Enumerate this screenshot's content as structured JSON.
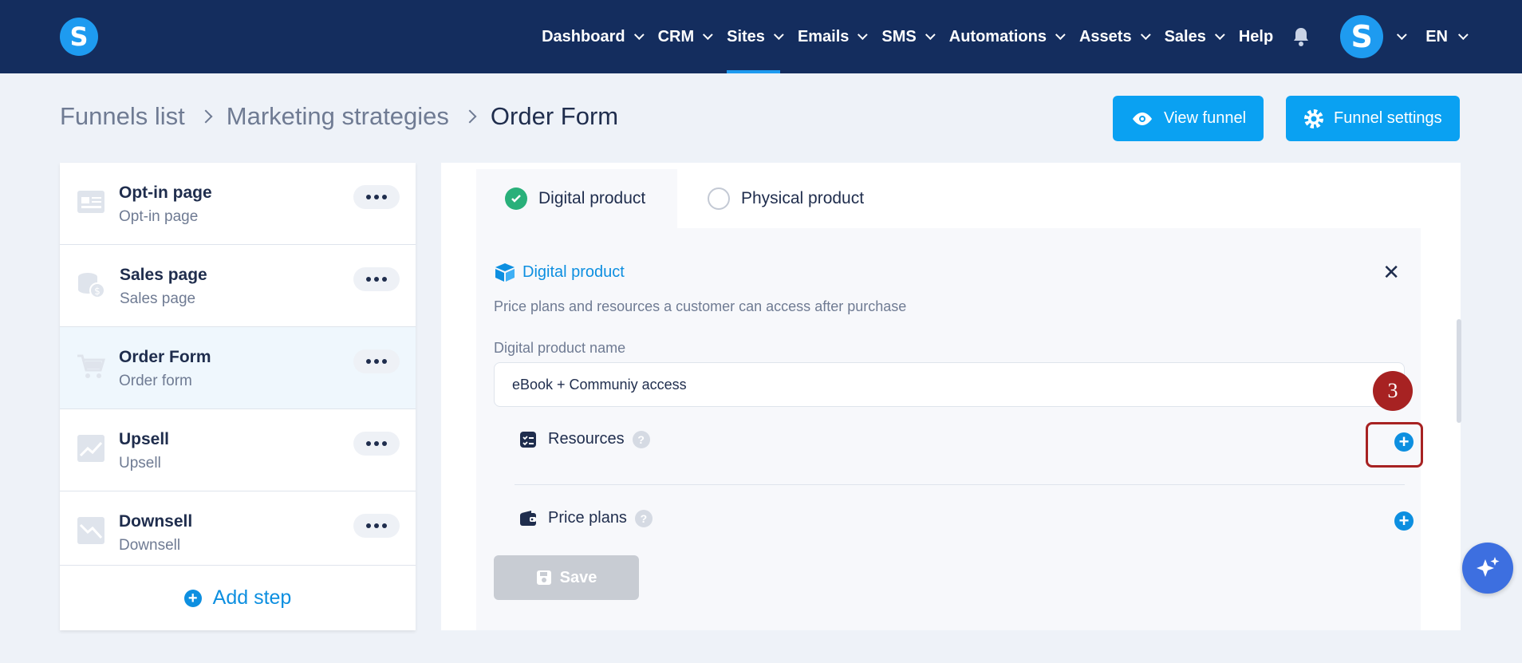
{
  "nav": {
    "logo": "S",
    "items": [
      {
        "label": "Dashboard"
      },
      {
        "label": "CRM"
      },
      {
        "label": "Sites"
      },
      {
        "label": "Emails"
      },
      {
        "label": "SMS"
      },
      {
        "label": "Automations"
      },
      {
        "label": "Assets"
      },
      {
        "label": "Sales"
      }
    ],
    "help": "Help",
    "avatar": "S",
    "lang": "EN",
    "active": "Sites"
  },
  "breadcrumb": {
    "items": [
      "Funnels list",
      "Marketing strategies",
      "Order Form"
    ]
  },
  "actions": {
    "view_funnel": "View funnel",
    "funnel_settings": "Funnel settings"
  },
  "steps": [
    {
      "title": "Opt-in page",
      "sub": "Opt-in page",
      "icon": "optin-page-icon"
    },
    {
      "title": "Sales page",
      "sub": "Sales page",
      "icon": "coins-icon"
    },
    {
      "title": "Order Form",
      "sub": "Order form",
      "icon": "cart-icon",
      "active": true
    },
    {
      "title": "Upsell",
      "sub": "Upsell",
      "icon": "chart-up-icon"
    },
    {
      "title": "Downsell",
      "sub": "Downsell",
      "icon": "chart-down-icon"
    }
  ],
  "add_step": "Add step",
  "tabs": {
    "digital": "Digital product",
    "physical": "Physical product",
    "selected": "digital"
  },
  "product": {
    "heading": "Digital product",
    "description": "Price plans and resources a customer can access after purchase",
    "name_label": "Digital product name",
    "name_value": "eBook + Communiy access",
    "resources": "Resources",
    "price_plans": "Price plans",
    "help_mark": "?",
    "save": "Save",
    "close": "✕"
  },
  "annotation": {
    "step_number": "3",
    "color": "#a72222"
  },
  "colors": {
    "navbar": "#142d5e",
    "accent": "#0aa1f2",
    "check": "#29b07a"
  }
}
